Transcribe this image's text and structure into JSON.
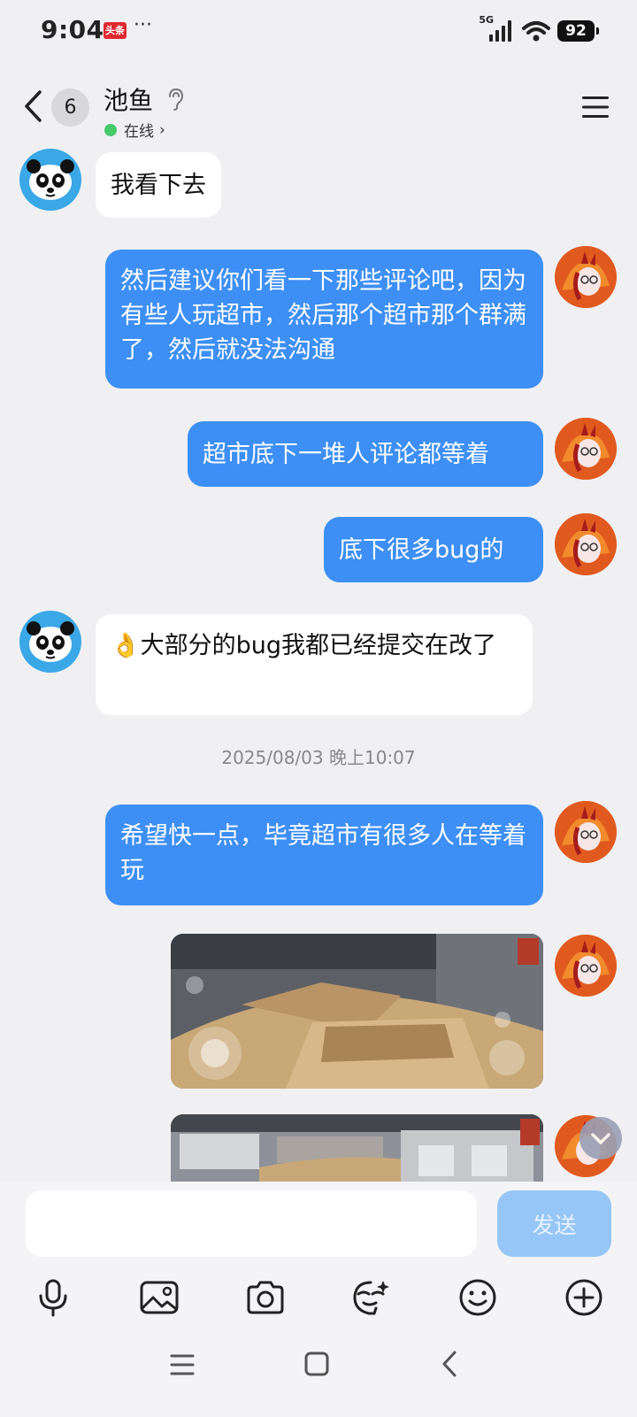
{
  "status_bar": {
    "time": "9:04",
    "news_app_label": "头条",
    "more_indicator": "···",
    "network": "5G",
    "battery": "92"
  },
  "header": {
    "unread_count": "6",
    "contact_name": "池鱼",
    "online_status": "在线",
    "online_chevron": "›"
  },
  "messages": [
    {
      "side": "in",
      "text": "我看下去"
    },
    {
      "side": "out",
      "text": "然后建议你们看一下那些评论吧，因为有些人玩超市，然后那个超市那个群满了，然后就没法沟通"
    },
    {
      "side": "out",
      "text": "超市底下一堆人评论都等着"
    },
    {
      "side": "out",
      "text": "底下很多bug的"
    },
    {
      "side": "in",
      "emoji": "👌",
      "text": "大部分的bug我都已经提交在改了"
    },
    {
      "side": "out",
      "text": "希望快一点，毕竟超市有很多人在等着玩"
    }
  ],
  "timestamp": "2025/08/03 晚上10:07",
  "composer": {
    "input_value": "",
    "send_label": "发送"
  },
  "toolbar_icons": [
    "microphone-icon",
    "image-icon",
    "camera-icon",
    "sticker-icon",
    "emoji-icon",
    "plus-icon"
  ],
  "navbar_icons": [
    "menu-icon",
    "home-icon",
    "back-icon"
  ],
  "colors": {
    "accent": "#3d8ff5",
    "send_disabled": "#95c6f7",
    "online": "#46c96b",
    "background": "#f0f0f3"
  }
}
